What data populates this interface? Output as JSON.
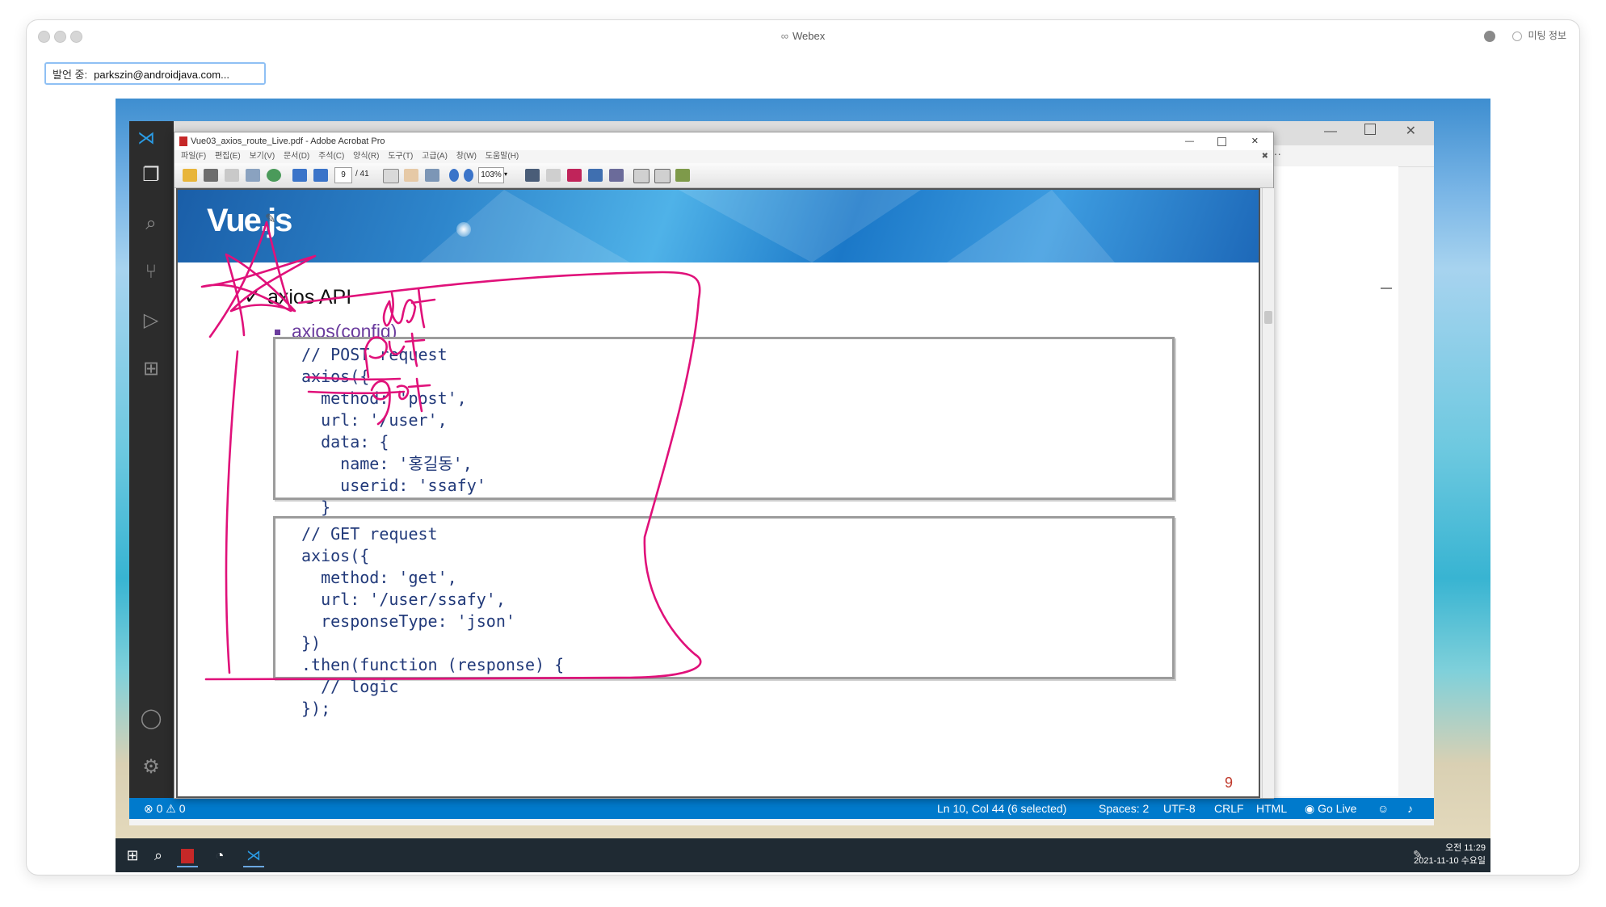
{
  "webex": {
    "title": "Webex",
    "speaker_label": "발언 중:",
    "speaker_name": "parkszin@androidjava.com...",
    "meeting_info": "미팅 정보"
  },
  "acrobat": {
    "title": "Vue03_axios_route_Live.pdf - Adobe Acrobat Pro",
    "menu": [
      "파일(F)",
      "편집(E)",
      "보기(V)",
      "문서(D)",
      "주석(C)",
      "양식(R)",
      "도구(T)",
      "고급(A)",
      "창(W)",
      "도움말(H)"
    ],
    "page_current": "9",
    "page_total": "/ 41",
    "zoom": "103%"
  },
  "slide": {
    "logo": "Vue.js",
    "heading": "axios API",
    "subheading": "axios(config)",
    "post_code": "// POST request\naxios({\n  method: 'post',\n  url: '/user',\n  data: {\n    name: '홍길동',\n    userid: 'ssafy'\n  }\n});",
    "get_code": "// GET request\naxios({\n  method: 'get',\n  url: '/user/ssafy',\n  responseType: 'json'\n})\n.then(function (response) {\n  // logic\n});",
    "page_number": "9",
    "annotations": [
      "delete",
      "put",
      "get"
    ],
    "ink_color": "#e0117a"
  },
  "vscode": {
    "status_left": "⊗ 0 ⚠ 0",
    "status_position": "Ln 10, Col 44 (6 selected)",
    "status_spaces": "Spaces: 2",
    "status_encoding": "UTF-8",
    "status_eol": "CRLF",
    "status_language": "HTML",
    "status_golive": "Go Live",
    "accent": "#007acc"
  },
  "taskbar": {
    "time": "오전 11:29",
    "date": "2021-11-10 수요일"
  }
}
